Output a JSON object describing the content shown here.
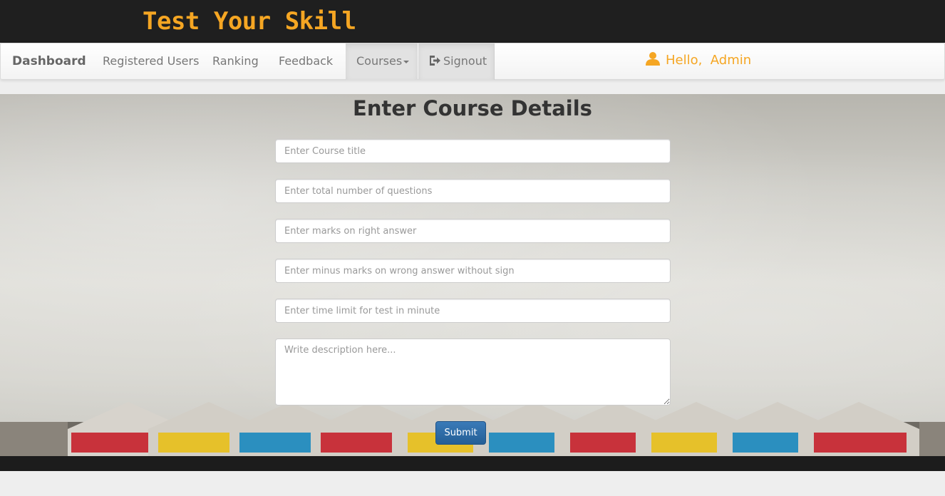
{
  "brand": {
    "title": "Test Your Skill",
    "color": "#f5a623"
  },
  "nav": {
    "items": [
      {
        "label": "Dashboard"
      },
      {
        "label": "Registered Users"
      },
      {
        "label": "Ranking"
      },
      {
        "label": "Feedback"
      },
      {
        "label": "Courses",
        "has_dropdown": true,
        "icon": "caret-down-icon"
      },
      {
        "label": "Signout",
        "icon": "sign-out-icon"
      }
    ],
    "greeting": {
      "icon": "user-icon",
      "text": "Hello,  Admin"
    }
  },
  "form": {
    "title": "Enter Course Details",
    "fields": [
      {
        "placeholder": "Enter Course title",
        "value": ""
      },
      {
        "placeholder": "Enter total number of questions",
        "value": ""
      },
      {
        "placeholder": "Enter marks on right answer",
        "value": ""
      },
      {
        "placeholder": "Enter minus marks on wrong answer without sign",
        "value": ""
      },
      {
        "placeholder": "Enter time limit for test in minute",
        "value": ""
      }
    ],
    "description": {
      "placeholder": "Write description here...",
      "value": ""
    },
    "submit_label": "Submit"
  }
}
